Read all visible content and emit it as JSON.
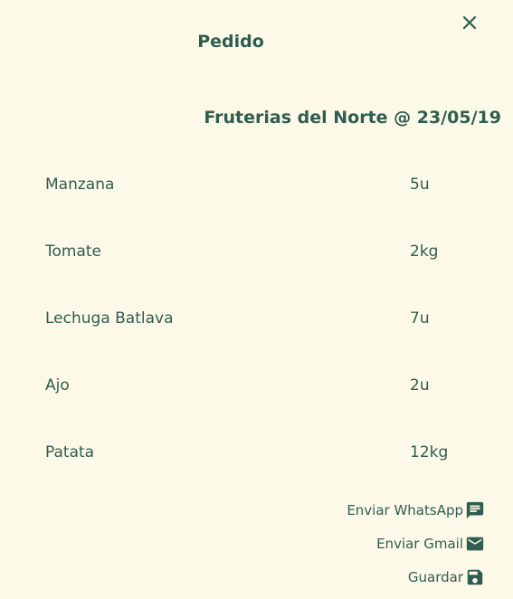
{
  "header": {
    "title": "Pedido",
    "close_icon": "close-icon"
  },
  "order": {
    "subtitle": "Fruterias del Norte @ 23/05/19",
    "items": [
      {
        "name": "Manzana",
        "qty": "5u"
      },
      {
        "name": "Tomate",
        "qty": "2kg"
      },
      {
        "name": "Lechuga Batlava",
        "qty": "7u"
      },
      {
        "name": "Ajo",
        "qty": "2u"
      },
      {
        "name": "Patata",
        "qty": "12kg"
      }
    ]
  },
  "actions": {
    "whatsapp_label": "Enviar WhatsApp",
    "whatsapp_icon": "message-icon",
    "gmail_label": "Enviar Gmail",
    "gmail_icon": "mail-icon",
    "save_label": "Guardar",
    "save_icon": "save-icon"
  },
  "colors": {
    "background": "#fdf9e8",
    "text": "#2f5d50"
  }
}
